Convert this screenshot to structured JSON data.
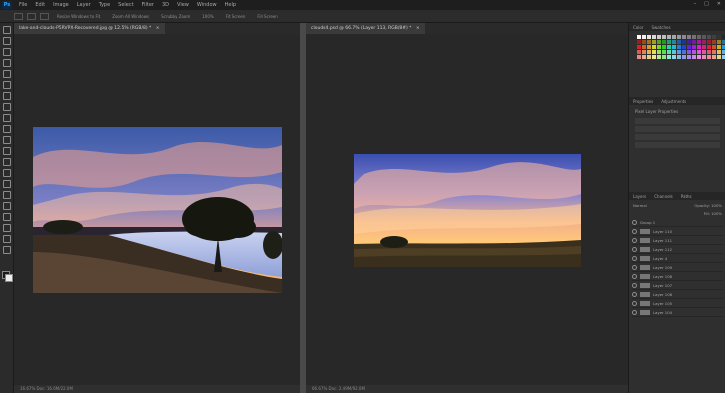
{
  "menu": [
    "File",
    "Edit",
    "Image",
    "Layer",
    "Type",
    "Select",
    "Filter",
    "3D",
    "View",
    "Window",
    "Help"
  ],
  "options": [
    "Resize Windows to Fit",
    "Zoom All Windows",
    "Scrubby Zoom",
    "100%",
    "Fit Screen",
    "Fill Screen"
  ],
  "left_doc": {
    "tab": "lake-and-clouds-P5RVPX-Recovered.jpg @ 12.5% (RGB/8) *",
    "status": "16.67%     Doc: 16.6M/22.0M"
  },
  "right_doc": {
    "tab": "clouds4.psd @ 66.7% (Layer 113, RGB/8#) *",
    "status": "66.67%     Doc: 2.49M/92.0M"
  },
  "panels": {
    "swatch_tabs": [
      "Color",
      "Swatches"
    ],
    "props_tabs": [
      "Properties",
      "Adjustments"
    ],
    "props_title": "Pixel Layer Properties",
    "layers_tabs": [
      "Layers",
      "Channels",
      "Paths"
    ],
    "blend": "Normal",
    "opacity": "Opacity: 100%",
    "fill": "Fill: 100%",
    "layers": [
      "Group 1",
      "Layer 110",
      "Layer 111",
      "Layer 112",
      "Layer 4",
      "Layer 109",
      "Layer 108",
      "Layer 107",
      "Layer 106",
      "Layer 105",
      "Layer 104"
    ]
  }
}
